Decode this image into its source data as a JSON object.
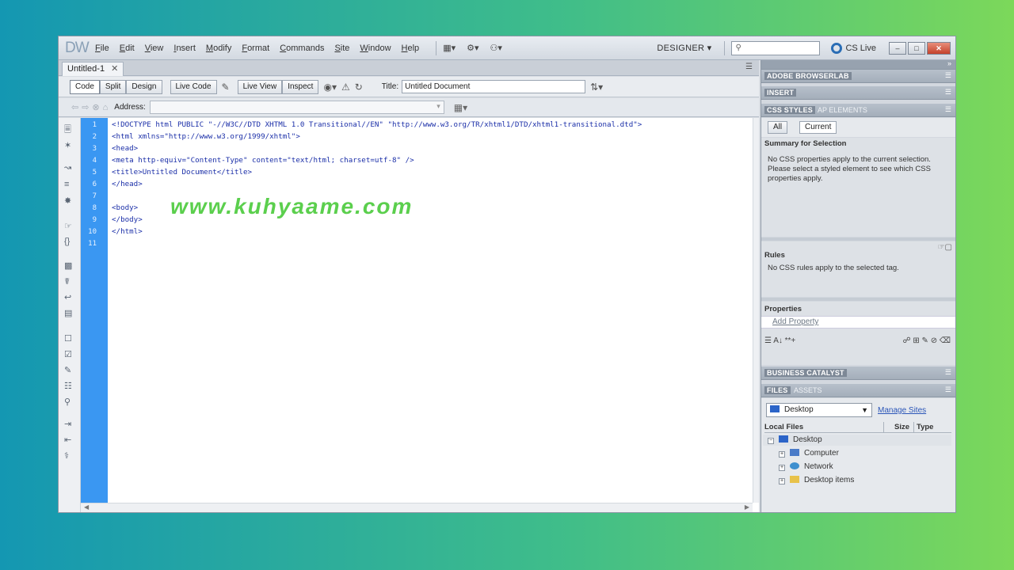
{
  "app": {
    "logo": "DW",
    "menu": [
      "File",
      "Edit",
      "View",
      "Insert",
      "Modify",
      "Format",
      "Commands",
      "Site",
      "Window",
      "Help"
    ],
    "toolbar_icons": [
      "layout-icon",
      "settings-icon",
      "site-icon"
    ],
    "workspace": "DESIGNER",
    "search_placeholder": "",
    "cslive_label": "CS Live"
  },
  "document": {
    "tab_label": "Untitled-1",
    "view_buttons": [
      "Code",
      "Split",
      "Design",
      "Live Code",
      "Live View",
      "Inspect"
    ],
    "active_view": "Code",
    "title_label": "Title:",
    "title_value": "Untitled Document",
    "address_label": "Address:",
    "address_value": ""
  },
  "code": {
    "line_numbers": [
      "1",
      "2",
      "3",
      "4",
      "5",
      "6",
      "7",
      "8",
      "9",
      "10",
      "11"
    ],
    "lines": [
      "<!DOCTYPE html PUBLIC \"-//W3C//DTD XHTML 1.0 Transitional//EN\" \"http://www.w3.org/TR/xhtml1/DTD/xhtml1-transitional.dtd\">",
      "<html xmlns=\"http://www.w3.org/1999/xhtml\">",
      "<head>",
      "<meta http-equiv=\"Content-Type\" content=\"text/html; charset=utf-8\" />",
      "<title>Untitled Document</title>",
      "</head>",
      "",
      "<body>",
      "</body>",
      "</html>",
      ""
    ]
  },
  "watermark": "www.kuhyaame.com",
  "panels": {
    "browserlab": "ADOBE BROWSERLAB",
    "insert": "INSERT",
    "css_tabs": [
      "CSS STYLES",
      "AP ELEMENTS"
    ],
    "css_mode": [
      "All",
      "Current"
    ],
    "summary_title": "Summary for Selection",
    "summary_text": "No CSS properties apply to the current selection. Please select a styled element to see which CSS properties apply.",
    "rules_title": "Rules",
    "rules_text": "No CSS rules apply to the selected tag.",
    "properties_title": "Properties",
    "add_property": "Add Property",
    "business_catalyst": "BUSINESS CATALYST",
    "files_tabs": [
      "FILES",
      "ASSETS"
    ],
    "site_select": "Desktop",
    "manage_sites": "Manage Sites",
    "columns": [
      "Local Files",
      "Size",
      "Type"
    ],
    "tree": [
      {
        "name": "Desktop",
        "level": 0
      },
      {
        "name": "Computer",
        "level": 1
      },
      {
        "name": "Network",
        "level": 1
      },
      {
        "name": "Desktop items",
        "level": 1
      }
    ]
  },
  "colors": {
    "gutter": "#3a97f2",
    "code_text": "#1b2fa8",
    "watermark": "#5bcf4d"
  }
}
